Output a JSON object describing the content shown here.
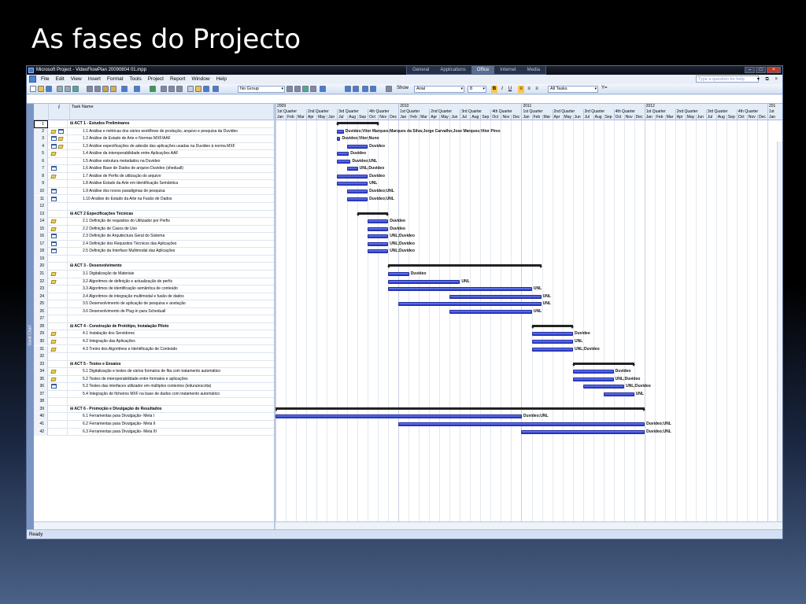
{
  "slide": {
    "title": "As fases do Projecto"
  },
  "window": {
    "title": "Microsoft Project - VideoFlowPlan 20090804 01.mpp",
    "workspaces": [
      "General",
      "Applications",
      "Office",
      "Internet",
      "Media"
    ],
    "active_workspace": "Office",
    "controls": {
      "min": "–",
      "max": "□",
      "close": "×"
    }
  },
  "menu": {
    "items": [
      "File",
      "Edit",
      "View",
      "Insert",
      "Format",
      "Tools",
      "Project",
      "Report",
      "Window",
      "Help"
    ],
    "help_placeholder": "Type a question for help",
    "mdi_controls": "▾ ⧉ ×"
  },
  "toolbar": {
    "group": "No Group",
    "show_label": "Show",
    "font": "Arial",
    "size": "8",
    "bold": "B",
    "italic": "I",
    "underline": "U",
    "filter": "All Tasks",
    "filter_icon": "Y="
  },
  "sidebar_label": "Gantt Chart",
  "table": {
    "header_info": "i",
    "header_name": "Task Name",
    "rows": [
      {
        "id": "1",
        "name": "ACT 1 - Estudos Preliminares",
        "sum": true,
        "ind": []
      },
      {
        "id": "2",
        "name": "1.1 Análise e métricas dos vários workflows de produção, arquivo e pesquisa da Duvideo",
        "ind": [
          "note",
          "cal"
        ]
      },
      {
        "id": "3",
        "name": "1.2 Análise de Estado de Arte e Normas MXF/AAF",
        "ind": [
          "cal",
          "note"
        ]
      },
      {
        "id": "4",
        "name": "1.3 Análise especificações de adesão das aplicações usadas na Duvideo à norma MXF",
        "ind": [
          "cal",
          "note"
        ]
      },
      {
        "id": "5",
        "name": "1.4 Análise da interoperabilidade entre Aplicações AAF",
        "ind": [
          "note"
        ]
      },
      {
        "id": "6",
        "name": "1.5 Análise estrutura metadados na Duvideo",
        "ind": []
      },
      {
        "id": "7",
        "name": "1.6 Análise Base de Dados de arquivo Duvideo (sheduall)",
        "ind": [
          "cal"
        ]
      },
      {
        "id": "8",
        "name": "1.7 Análise de Perfis de utilização do arquivo",
        "ind": [
          "note"
        ]
      },
      {
        "id": "9",
        "name": "1.8 Análise Estado da Arte em identificação Semântica",
        "ind": []
      },
      {
        "id": "10",
        "name": "1.9 Análise dos novos paradigmas de pesquisa",
        "ind": [
          "cal"
        ]
      },
      {
        "id": "11",
        "name": "1.10 Análise do Estado da Arte na Fusão de Dados",
        "ind": [
          "cal"
        ]
      },
      {
        "id": "12",
        "name": "",
        "ind": []
      },
      {
        "id": "13",
        "name": "ACT 2 Especificações Técnicas",
        "sum": true,
        "ind": []
      },
      {
        "id": "14",
        "name": "2.1 Definição de requisitos do Utilizador por Perfis",
        "ind": [
          "note"
        ]
      },
      {
        "id": "15",
        "name": "2.2 Definição de Casos de Uso",
        "ind": [
          "note"
        ]
      },
      {
        "id": "16",
        "name": "2.3 Definição de Arquitectura Geral do Sistema",
        "ind": [
          "cal"
        ]
      },
      {
        "id": "17",
        "name": "2.4 Definição dos Requisitos Técnicos das Aplicações",
        "ind": [
          "cal"
        ]
      },
      {
        "id": "18",
        "name": "2.5 Definição da Interface Multimodal das Aplicações",
        "ind": [
          "cal"
        ]
      },
      {
        "id": "19",
        "name": "",
        "ind": []
      },
      {
        "id": "20",
        "name": "ACT 3 - Desenvolvimento",
        "sum": true,
        "ind": []
      },
      {
        "id": "21",
        "name": "3.1 Digitalização de Materiais",
        "ind": [
          "note"
        ]
      },
      {
        "id": "22",
        "name": "3.2 Algoritmos de definição e actualização de perfis",
        "ind": [
          "note"
        ]
      },
      {
        "id": "23",
        "name": "3.3 Algoritmos de identificação semântica de conteúdo",
        "ind": []
      },
      {
        "id": "24",
        "name": "3.4 Algoritmos de integração multimodal e fusão de dados",
        "ind": []
      },
      {
        "id": "25",
        "name": "3.5 Desenvolvimento de aplicação de pesquisa e anotação",
        "ind": []
      },
      {
        "id": "26",
        "name": "3.6 Desenvolvimento de Plug-in para Scheduall",
        "ind": []
      },
      {
        "id": "27",
        "name": "",
        "ind": []
      },
      {
        "id": "28",
        "name": "ACT 4 - Construção de Protótipo, Instalação Piloto",
        "sum": true,
        "ind": []
      },
      {
        "id": "29",
        "name": "4.1 Instalação dos Servidores",
        "ind": [
          "note"
        ]
      },
      {
        "id": "30",
        "name": "4.2 Integração das Aplicações",
        "ind": [
          "note"
        ]
      },
      {
        "id": "31",
        "name": "4.3 Treino dos Algoritmos e Identificação de Conteúdo",
        "ind": [
          "note"
        ]
      },
      {
        "id": "32",
        "name": "",
        "ind": []
      },
      {
        "id": "33",
        "name": "ACT 5 - Testes e Ensaios",
        "sum": true,
        "ind": []
      },
      {
        "id": "34",
        "name": "5.1 Digitalização e testes de vários formatos de fita com tratamento automático",
        "ind": [
          "note"
        ]
      },
      {
        "id": "35",
        "name": "5.2 Testes de interoperabilidade entre formatos e aplicações",
        "ind": [
          "note"
        ]
      },
      {
        "id": "36",
        "name": "5.3 Testes das interfaces utilizador em múltiplos contextos (leitura/escrita)",
        "ind": [
          "cal"
        ]
      },
      {
        "id": "37",
        "name": "5.4 Integração de ficheiros MXF na base de dados com tratamento automático",
        "ind": []
      },
      {
        "id": "38",
        "name": "",
        "ind": []
      },
      {
        "id": "39",
        "name": "ACT 6 - Promoção e Divulgação de Resultados",
        "sum": true,
        "ind": []
      },
      {
        "id": "40",
        "name": "6.1 Ferramentas para Divulgação- Meta I",
        "ind": []
      },
      {
        "id": "41",
        "name": "6.2 Ferramentas para Divulgação- Meta II",
        "ind": []
      },
      {
        "id": "42",
        "name": "6.3 Ferramentas para Divulgação- Meta III",
        "ind": []
      }
    ]
  },
  "timescale": {
    "years": [
      "2009",
      "2010",
      "2011",
      "2012",
      "201"
    ],
    "quarters": [
      "1st Quarter",
      "2nd Quarter",
      "3rd Quarter",
      "4th Quarter",
      "1st Quarter",
      "2nd Quarter",
      "3rd Quarter",
      "4th Quarter",
      "1st Quarter",
      "2nd Quarter",
      "3rd Quarter",
      "4th Quarter",
      "1st Quarter",
      "2nd Quarter",
      "3rd Quarter",
      "4th Quarter",
      "1st"
    ],
    "months": [
      "Jan",
      "Feb",
      "Mar",
      "Apr",
      "May",
      "Jun",
      "Jul",
      "Aug",
      "Sep",
      "Oct",
      "Nov",
      "Dec",
      "Jan",
      "Feb",
      "Mar",
      "Apr",
      "May",
      "Jun",
      "Jul",
      "Aug",
      "Sep",
      "Oct",
      "Nov",
      "Dec",
      "Jan",
      "Feb",
      "Mar",
      "Apr",
      "May",
      "Jun",
      "Jul",
      "Aug",
      "Sep",
      "Oct",
      "Nov",
      "Dec",
      "Jan",
      "Feb",
      "Mar",
      "Apr",
      "May",
      "Jun",
      "Jul",
      "Aug",
      "Sep",
      "Oct",
      "Nov",
      "Dec",
      "Jan"
    ]
  },
  "gantt": {
    "tasks": [
      {
        "row": 1,
        "type": "summary",
        "start": "2009-07-01",
        "end": "2009-10-31"
      },
      {
        "row": 2,
        "type": "task",
        "start": "2009-07-01",
        "end": "2009-07-20",
        "label": "Duvideo;Vitor Marques;Marques da Silva;Jorge Carvalho;Jose Marques;Vitor Pires"
      },
      {
        "row": 3,
        "type": "task",
        "start": "2009-07-01",
        "end": "2009-07-10",
        "label": "Duvideo;Vitor;Nuno"
      },
      {
        "row": 4,
        "type": "task",
        "start": "2009-08-01",
        "end": "2009-09-30",
        "label": "Duvideo"
      },
      {
        "row": 5,
        "type": "task",
        "start": "2009-07-01",
        "end": "2009-08-05",
        "label": "Duvideo"
      },
      {
        "row": 6,
        "type": "task",
        "start": "2009-07-01",
        "end": "2009-08-10",
        "label": "Duvideo;UNL"
      },
      {
        "row": 7,
        "type": "task",
        "start": "2009-08-01",
        "end": "2009-09-01",
        "label": "UNL;Duvideo"
      },
      {
        "row": 8,
        "type": "task",
        "start": "2009-07-01",
        "end": "2009-09-30",
        "label": "Duvideo"
      },
      {
        "row": 9,
        "type": "task",
        "start": "2009-07-01",
        "end": "2009-09-30",
        "label": "UNL"
      },
      {
        "row": 10,
        "type": "task",
        "start": "2009-08-01",
        "end": "2009-09-30",
        "label": "Duvideo;UNL"
      },
      {
        "row": 11,
        "type": "task",
        "start": "2009-08-01",
        "end": "2009-09-30",
        "label": "Duvideo;UNL"
      },
      {
        "row": 13,
        "type": "summary",
        "start": "2009-09-01",
        "end": "2009-11-30"
      },
      {
        "row": 14,
        "type": "task",
        "start": "2009-10-01",
        "end": "2009-11-30",
        "label": "Duvideo"
      },
      {
        "row": 15,
        "type": "task",
        "start": "2009-10-01",
        "end": "2009-11-30",
        "label": "Duvideo"
      },
      {
        "row": 16,
        "type": "task",
        "start": "2009-10-01",
        "end": "2009-11-30",
        "label": "UNL;Duvideo"
      },
      {
        "row": 17,
        "type": "task",
        "start": "2009-10-01",
        "end": "2009-11-30",
        "label": "UNL;Duvideo"
      },
      {
        "row": 18,
        "type": "task",
        "start": "2009-10-01",
        "end": "2009-11-30",
        "label": "UNL;Duvideo"
      },
      {
        "row": 20,
        "type": "summary",
        "start": "2009-12-01",
        "end": "2011-02-28"
      },
      {
        "row": 21,
        "type": "task",
        "start": "2009-12-01",
        "end": "2010-01-31",
        "label": "Duvideo"
      },
      {
        "row": 22,
        "type": "task",
        "start": "2009-12-01",
        "end": "2010-06-30",
        "label": "UNL"
      },
      {
        "row": 23,
        "type": "task",
        "start": "2009-12-01",
        "end": "2011-01-31",
        "label": "UNL"
      },
      {
        "row": 24,
        "type": "task",
        "start": "2010-06-01",
        "end": "2011-02-28",
        "label": "UNL"
      },
      {
        "row": 25,
        "type": "task",
        "start": "2010-01-01",
        "end": "2011-02-28",
        "label": "UNL"
      },
      {
        "row": 26,
        "type": "task",
        "start": "2010-06-01",
        "end": "2011-01-31",
        "label": "UNL"
      },
      {
        "row": 28,
        "type": "summary",
        "start": "2011-02-01",
        "end": "2011-05-31"
      },
      {
        "row": 29,
        "type": "task",
        "start": "2011-02-01",
        "end": "2011-05-31",
        "label": "Duvideo"
      },
      {
        "row": 30,
        "type": "task",
        "start": "2011-02-01",
        "end": "2011-05-31",
        "label": "UNL"
      },
      {
        "row": 31,
        "type": "task",
        "start": "2011-02-01",
        "end": "2011-05-31",
        "label": "UNL;Duvideo"
      },
      {
        "row": 33,
        "type": "summary",
        "start": "2011-06-01",
        "end": "2011-11-30"
      },
      {
        "row": 34,
        "type": "task",
        "start": "2011-06-01",
        "end": "2011-09-30",
        "label": "Duvideo"
      },
      {
        "row": 35,
        "type": "task",
        "start": "2011-06-01",
        "end": "2011-09-30",
        "label": "UNL;Duvideo"
      },
      {
        "row": 36,
        "type": "task",
        "start": "2011-07-01",
        "end": "2011-10-31",
        "label": "UNL;Duvideo"
      },
      {
        "row": 37,
        "type": "task",
        "start": "2011-09-01",
        "end": "2011-11-30",
        "label": "UNL"
      },
      {
        "row": 39,
        "type": "summary",
        "start": "2009-01-01",
        "end": "2011-12-31"
      },
      {
        "row": 40,
        "type": "task",
        "start": "2009-01-01",
        "end": "2010-12-31",
        "label": "Duvideo;UNL"
      },
      {
        "row": 41,
        "type": "task",
        "start": "2010-01-01",
        "end": "2011-12-31",
        "label": "Duvideo;UNL"
      },
      {
        "row": 42,
        "type": "task",
        "start": "2011-01-01",
        "end": "2011-12-31",
        "label": "Duvideo;UNL"
      }
    ]
  },
  "status": {
    "text": "Ready"
  }
}
